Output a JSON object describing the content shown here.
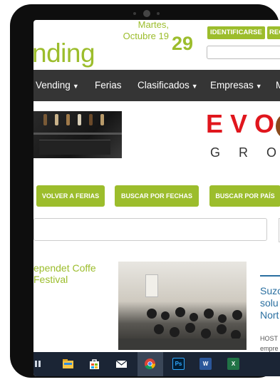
{
  "header": {
    "logo_text": "nding",
    "date_day": "Martes,",
    "date_month": "Octubre 19",
    "date_number": "29",
    "login_label": "IDENTIFICARSE",
    "register_label": "REGISTRARSE"
  },
  "nav": {
    "items": [
      {
        "label": "Vending",
        "has_caret": true
      },
      {
        "label": "Ferias",
        "has_caret": false
      },
      {
        "label": "Clasificados",
        "has_caret": true
      },
      {
        "label": "Empresas",
        "has_caret": true
      },
      {
        "label": "M",
        "has_caret": false
      }
    ],
    "caret": "▼"
  },
  "banner": {
    "brand_top": "EVO",
    "brand_bottom": "GRO"
  },
  "actions": {
    "back_to_fairs": "VOLVER A FERIAS",
    "search_by_dates": "BUSCAR POR FECHAS",
    "search_by_country": "BUSCAR POR PAÍS"
  },
  "articles": {
    "first_title": "ependet Coffe Festival",
    "second_title": "Suzo solu Nort",
    "second_desc": "HOST empre"
  },
  "taskbar": {
    "icons": [
      "task-view-icon",
      "file-explorer-icon",
      "store-icon",
      "mail-icon",
      "chrome-icon",
      "photoshop-icon",
      "word-icon",
      "excel-icon"
    ],
    "ps_label": "Ps",
    "word_label": "W",
    "excel_label": "X"
  },
  "colors": {
    "brand_green": "#9cbd2c",
    "nav_bg": "#353535",
    "evo_red": "#e0161d",
    "taskbar_bg": "#1b2535",
    "link_blue": "#2a6fa0"
  }
}
